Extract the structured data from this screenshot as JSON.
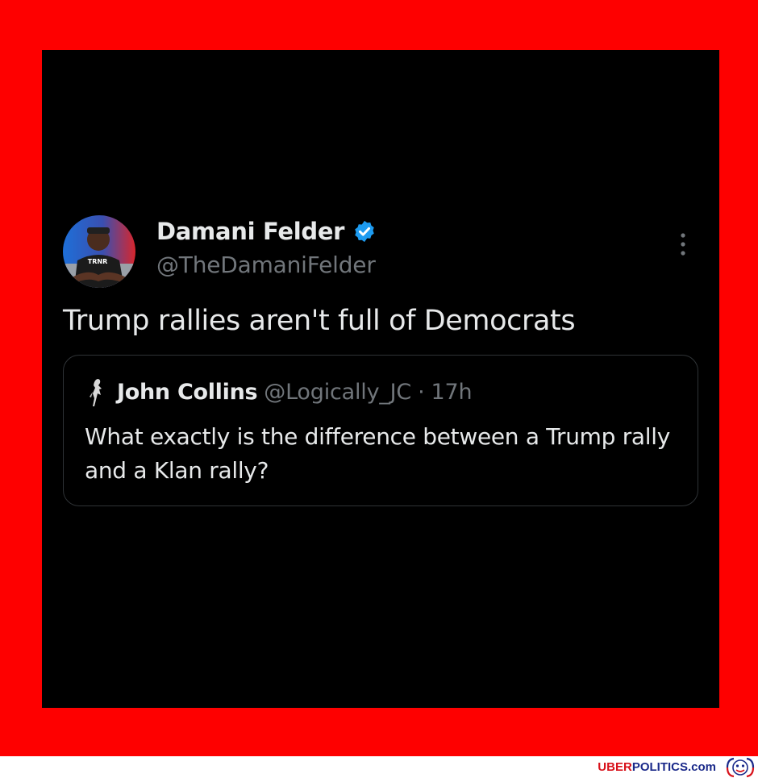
{
  "frame": {
    "border_color": "#fe0000",
    "background": "#000000"
  },
  "tweet": {
    "author_name": "Damani Felder",
    "author_handle": "@TheDamaniFelder",
    "verified": true,
    "verified_color": "#1d9bf0",
    "text": "Trump rallies aren't full of Democrats",
    "avatar_shirt_text": "TRNR",
    "more_icon": "more-vertical-icon"
  },
  "quote": {
    "author_name": "John Collins",
    "author_handle": "@Logically_JC",
    "separator": "·",
    "time": "17h",
    "text": "What exactly is the difference between a Trump rally and a Klan rally?"
  },
  "watermark": {
    "part1": "UBER",
    "part2": "POLITICS",
    "part3": ".com",
    "logo_icon": "mascot-logo-icon"
  }
}
